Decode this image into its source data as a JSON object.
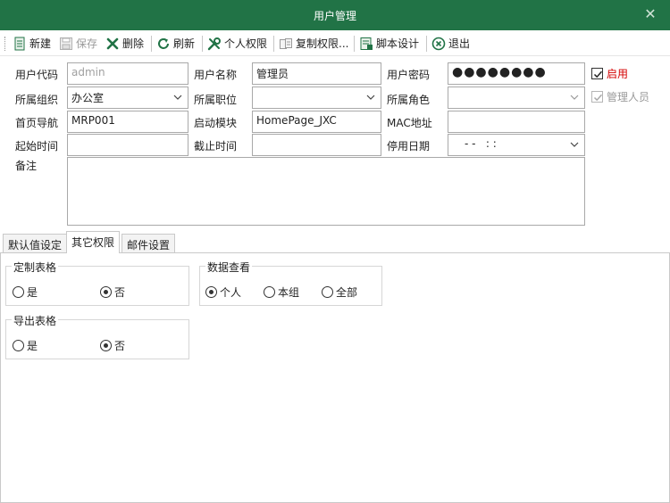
{
  "window": {
    "title": "用户管理",
    "close_symbol": "✕"
  },
  "toolbar": {
    "new": "新建",
    "save": "保存",
    "delete": "删除",
    "refresh": "刷新",
    "personal_permission": "个人权限",
    "copy_permission": "复制权限...",
    "script_design": "脚本设计",
    "exit": "退出"
  },
  "form": {
    "user_code": {
      "label": "用户代码",
      "value": "admin"
    },
    "user_name": {
      "label": "用户名称",
      "value": "管理员"
    },
    "password": {
      "label": "用户密码",
      "value": "●●●●●●●●"
    },
    "enabled": {
      "label": "启用",
      "checked": true
    },
    "org": {
      "label": "所属组织",
      "value": "办公室"
    },
    "position": {
      "label": "所属职位",
      "value": ""
    },
    "role": {
      "label": "所属角色",
      "value": ""
    },
    "admin": {
      "label": "管理人员",
      "checked": true
    },
    "home_nav": {
      "label": "首页导航",
      "value": "MRP001"
    },
    "start_module": {
      "label": "启动模块",
      "value": "HomePage_JXC"
    },
    "mac": {
      "label": "MAC地址",
      "value": ""
    },
    "start_time": {
      "label": "起始时间",
      "value": ""
    },
    "end_time": {
      "label": "截止时间",
      "value": ""
    },
    "disable_date": {
      "label": "停用日期",
      "value": "- -   : :"
    },
    "remark": {
      "label": "备注",
      "value": ""
    }
  },
  "tabs": [
    {
      "label": "默认值设定",
      "active": false
    },
    {
      "label": "其它权限",
      "active": true
    },
    {
      "label": "邮件设置",
      "active": false
    }
  ],
  "panel": {
    "custom_table": {
      "title": "定制表格",
      "options": [
        "是",
        "否"
      ],
      "selected": "否"
    },
    "data_view": {
      "title": "数据查看",
      "options": [
        "个人",
        "本组",
        "全部"
      ],
      "selected": "个人"
    },
    "export_table": {
      "title": "导出表格",
      "options": [
        "是",
        "否"
      ],
      "selected": "否"
    }
  },
  "colors": {
    "titlebar": "#217346",
    "enabled_label": "#d40000",
    "border": "#a9a9a9"
  }
}
